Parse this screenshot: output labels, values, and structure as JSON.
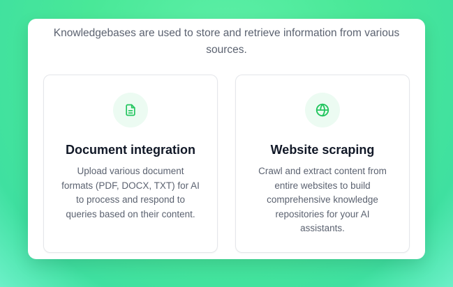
{
  "intro": "Knowledgebases are used to store and retrieve information from various sources.",
  "colors": {
    "accent": "#22c55e",
    "icon_bg": "#ecfbf2",
    "background": "#49e898"
  },
  "cards": [
    {
      "icon": "document-icon",
      "title": "Document integration",
      "description": "Upload various document formats (PDF, DOCX, TXT) for AI to process and respond to queries based on their content."
    },
    {
      "icon": "globe-icon",
      "title": "Website scraping",
      "description": "Crawl and extract content from entire websites to build comprehensive knowledge repositories for your AI assistants."
    }
  ]
}
